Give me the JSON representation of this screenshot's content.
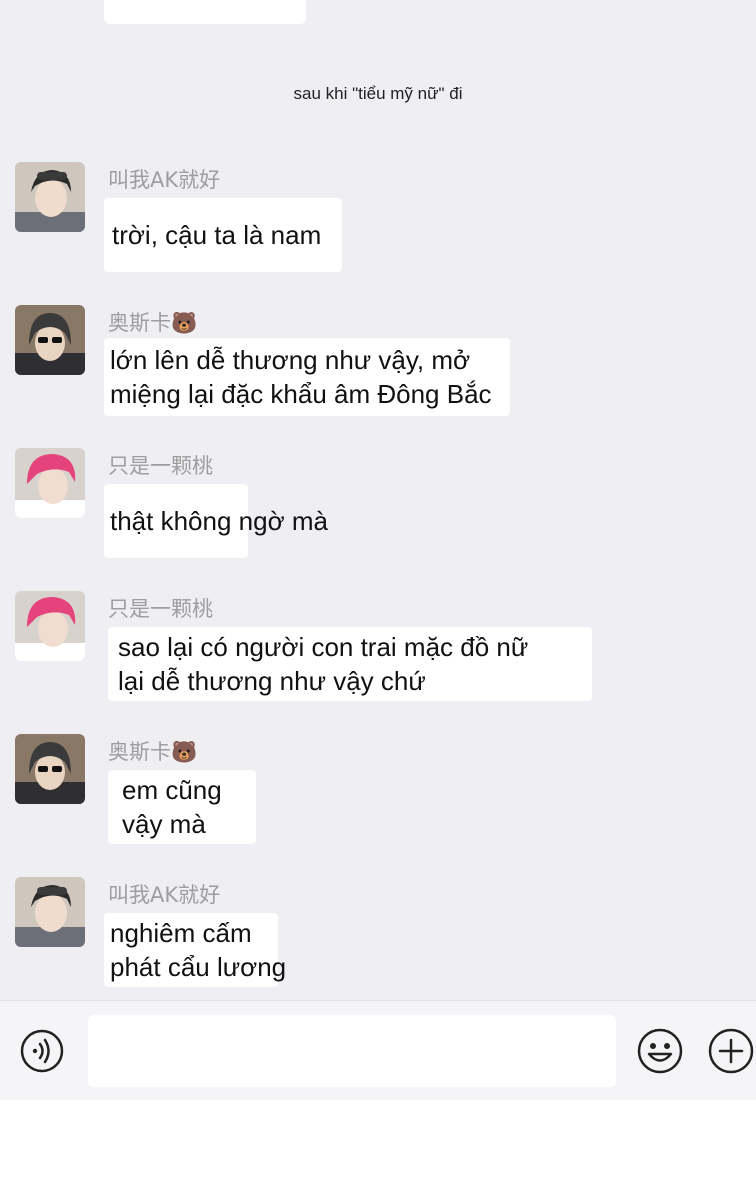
{
  "system_note": "sau khi \"tiểu mỹ nữ\" đi",
  "messages": [
    {
      "sender": "叫我AK就好",
      "lines": [
        "trời, cậu ta là nam"
      ]
    },
    {
      "sender": "奥斯卡🐻",
      "lines": [
        "lớn lên dễ thương như vậy, mở",
        "miệng lại đặc khẩu âm Đông Bắc"
      ]
    },
    {
      "sender": "只是一颗桃",
      "lines": [
        "thật không ngờ mà"
      ]
    },
    {
      "sender": "只是一颗桃",
      "lines": [
        "sao lại có người con trai mặc đồ nữ",
        "lại dễ thương như vậy chứ"
      ]
    },
    {
      "sender": "奥斯卡🐻",
      "lines": [
        "em cũng",
        "vậy mà"
      ]
    },
    {
      "sender": "叫我AK就好",
      "lines": [
        "nghiêm cấm",
        "phát cẩu lương"
      ]
    }
  ],
  "input_bar": {
    "text_value": "",
    "voice_icon": "voice-icon",
    "emoji_icon": "emoji-icon",
    "plus_icon": "plus-icon"
  },
  "colors": {
    "chat_background": "#efeef3",
    "bubble": "#ffffff",
    "sender_name": "#9e9e9e"
  }
}
